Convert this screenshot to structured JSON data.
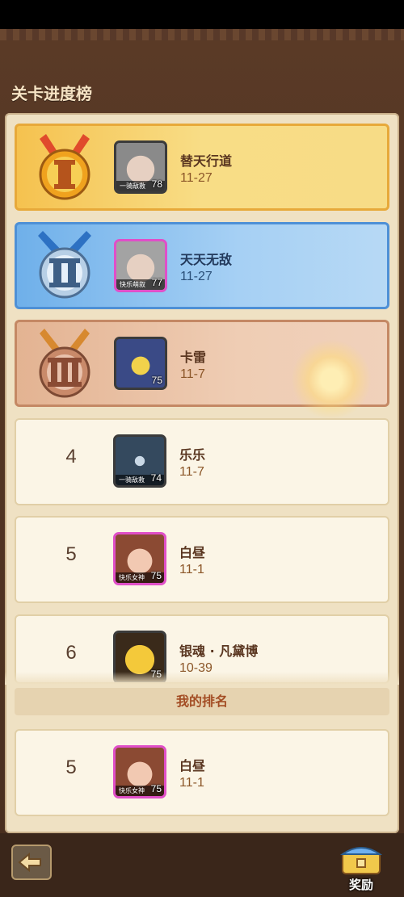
{
  "title": "关卡进度榜",
  "ranking": [
    {
      "rank": "I",
      "medal": "gold-medal",
      "name": "替天行道",
      "progress": "11-27",
      "level": "78",
      "tag": "一骑敌救",
      "avatar": "grey-haired-hero"
    },
    {
      "rank": "II",
      "medal": "silver-medal",
      "name": "天天无敌",
      "progress": "11-27",
      "level": "77",
      "tag": "快乐萌叙",
      "avatar": "grey-haired-hero"
    },
    {
      "rank": "III",
      "medal": "bronze-medal",
      "name": "卡雷",
      "progress": "11-7",
      "level": "75",
      "tag": "",
      "avatar": "robot-hero"
    },
    {
      "rank": "4",
      "name": "乐乐",
      "progress": "11-7",
      "level": "74",
      "tag": "一骑敌救",
      "avatar": "cow-hero"
    },
    {
      "rank": "5",
      "name": "白昼",
      "progress": "11-1",
      "level": "75",
      "tag": "快乐女神",
      "avatar": "girl-hero"
    },
    {
      "rank": "6",
      "name": "银魂 · 凡黛博",
      "progress": "10-39",
      "level": "75",
      "tag": "",
      "avatar": "yellow-creature"
    }
  ],
  "my_rank_label": "我的排名",
  "my_rank": {
    "rank": "5",
    "name": "白昼",
    "progress": "11-1",
    "level": "75",
    "tag": "快乐女神",
    "avatar": "girl-hero"
  },
  "buttons": {
    "back_icon": "back-arrow-icon",
    "reward_label": "奖励",
    "reward_icon": "treasure-chest-icon"
  }
}
